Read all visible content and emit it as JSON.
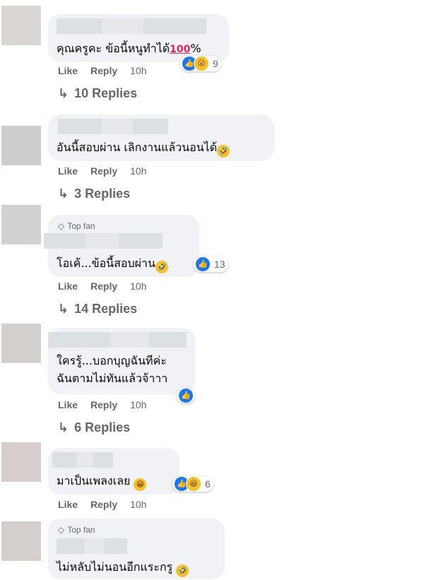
{
  "actions": {
    "like": "Like",
    "reply": "Reply"
  },
  "comments": [
    {
      "text": "คุณครูคะ ข้อนี้หนูทำได้",
      "suffix": "%",
      "time": "10h",
      "reactions": {
        "count": "9"
      },
      "replies": "10 Replies"
    },
    {
      "text": "อันนี้สอบผ่าน เลิกงานแล้วนอนได้",
      "time": "10h",
      "replies": "3 Replies"
    },
    {
      "badge": "Top fan",
      "text": "โอเค้...ข้อนี้สอบผ่าน",
      "time": "10h",
      "reactions": {
        "count": "13"
      },
      "replies": "14 Replies"
    },
    {
      "text_lines": [
        "ใครรู้...บอกบุญฉันทีค่ะ",
        "ฉันตามไม่ทันแล้วจ้าาา"
      ],
      "time": "10h",
      "replies": "6 Replies"
    },
    {
      "text": "มาเป็นเพลงเลย",
      "time": "10h",
      "reactions": {
        "count": "6"
      }
    },
    {
      "badge": "Top fan",
      "text": "ไม่หลับไม่นอนอีกแระกรู"
    }
  ],
  "icons": {
    "like": "like-icon",
    "haha": "haha-icon",
    "wow": "wow-icon",
    "grin": "grin-emoji",
    "hundred": "hundred-emoji",
    "diamond": "diamond-icon",
    "reply_arrow": "reply-arrow-icon"
  },
  "colors": {
    "bubble": "#f0f2f5",
    "secondary_text": "#65676b",
    "like_blue": "#1877f2"
  }
}
